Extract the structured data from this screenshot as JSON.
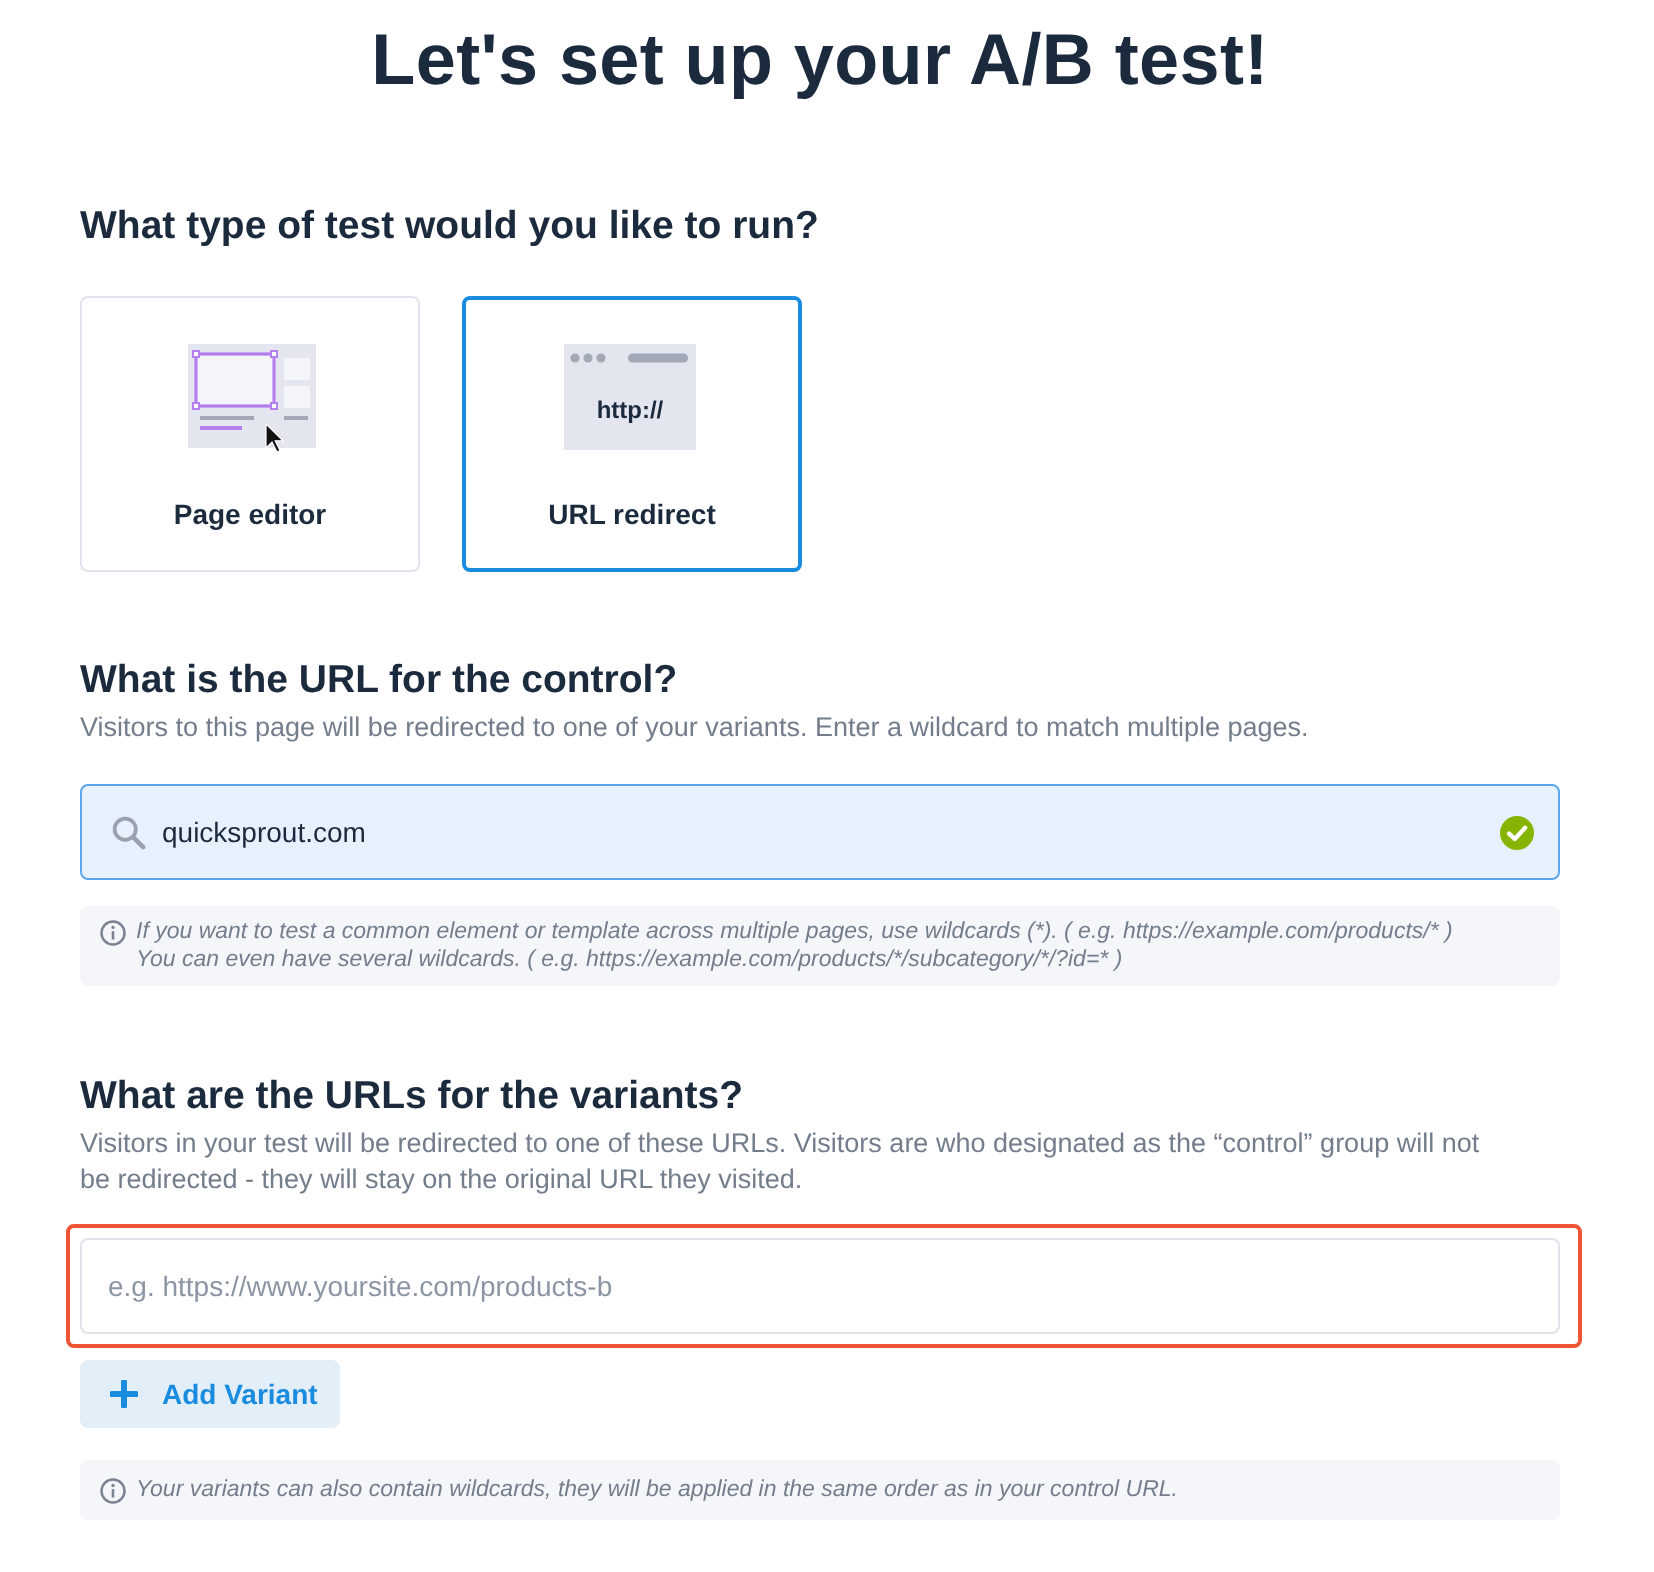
{
  "title": "Let's set up your A/B test!",
  "test_type": {
    "heading": "What type of test would you like to run?",
    "options": [
      {
        "kind": "page_editor",
        "label": "Page editor",
        "selected": false
      },
      {
        "kind": "url_redirect",
        "label": "URL redirect",
        "icon_text": "http://",
        "selected": true
      }
    ]
  },
  "control": {
    "heading": "What is the URL for the control?",
    "description": "Visitors to this page will be redirected to one of your variants. Enter a wildcard to match multiple pages.",
    "field": {
      "value": "quicksprout.com",
      "valid": true
    },
    "note": [
      "If you want to test a common element or template across multiple pages, use wildcards (*). ( e.g. https://example.com/products/* )",
      "You can even have several wildcards. ( e.g. https://example.com/products/*/subcategory/*/?id=* )"
    ]
  },
  "variants": {
    "heading": "What are the URLs for the variants?",
    "description": "Visitors in your test will be redirected to one of these URLs. Visitors are who designated as the “control” group will not be redirected - they will stay on the original URL they visited.",
    "field": {
      "placeholder": "e.g. https://www.yoursite.com/products-b",
      "highlighted": true
    },
    "add_button": "Add Variant",
    "note": [
      "Your variants can also contain wildcards, they will be applied in the same order as in your control URL."
    ]
  }
}
